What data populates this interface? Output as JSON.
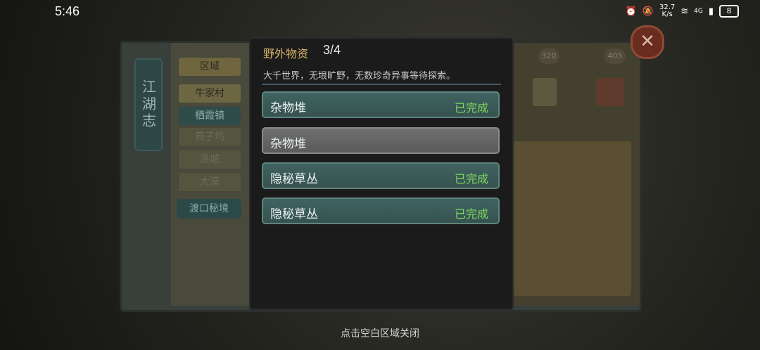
{
  "status_bar": {
    "time": "5:46",
    "net_speed_value": "32.7",
    "net_speed_unit": "K/s",
    "signal": "4G",
    "battery": "8"
  },
  "book": {
    "spine_title": "江湖志",
    "region_header": "区域",
    "regions": [
      "牛家村",
      "栖霞镇",
      "燕子坞",
      "洛城",
      "大漠"
    ],
    "ferry_button": "渡口秘境",
    "scores": [
      "320",
      "405"
    ]
  },
  "popup": {
    "title": "野外物资",
    "count": "3/4",
    "description": "大千世界，无垠旷野，无数珍奇异事等待探索。",
    "items": [
      {
        "label": "杂物堆",
        "status": "已完成"
      },
      {
        "label": "杂物堆",
        "status": ""
      },
      {
        "label": "隐秘草丛",
        "status": "已完成"
      },
      {
        "label": "隐秘草丛",
        "status": "已完成"
      }
    ]
  },
  "hint": "点击空白区域关闭"
}
